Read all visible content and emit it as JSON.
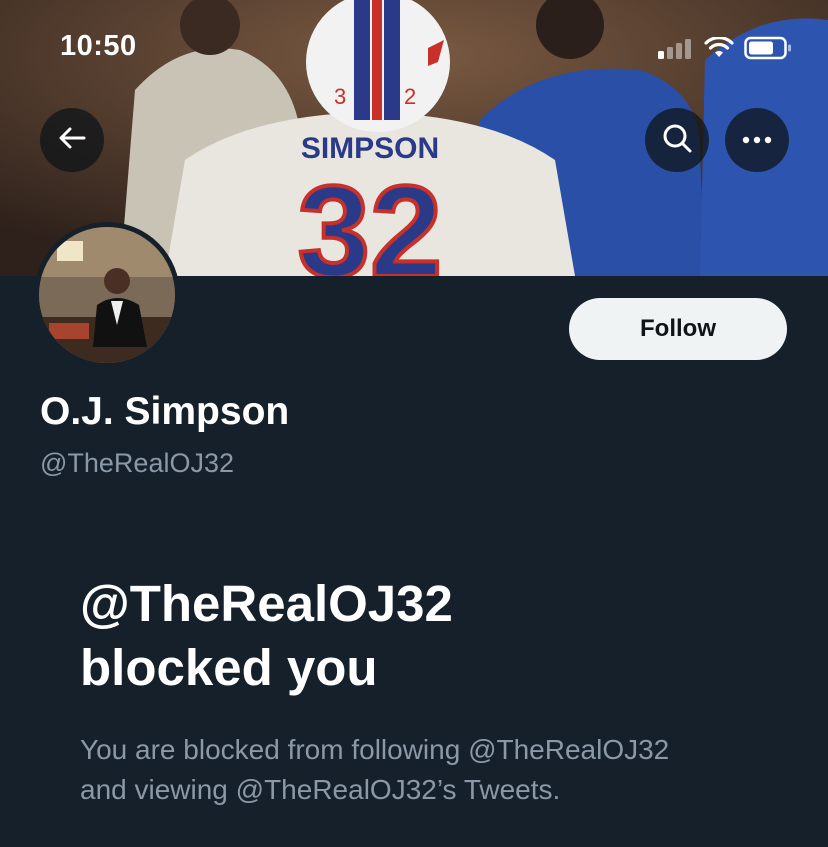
{
  "status_bar": {
    "time": "10:50"
  },
  "banner": {
    "jersey_name": "SIMPSON",
    "jersey_number": "32",
    "helmet_number_left": "3",
    "helmet_number_right": "2"
  },
  "profile": {
    "display_name": "O.J. Simpson",
    "handle": "@TheRealOJ32",
    "follow_label": "Follow"
  },
  "blocked": {
    "title_line1": "@TheRealOJ32",
    "title_line2": "blocked you",
    "desc_line1": "You are blocked from following @TheRealOJ32",
    "desc_line2": "and viewing @TheRealOJ32’s Tweets."
  },
  "colors": {
    "background": "#15202b",
    "follow_bg": "#eff3f4",
    "secondary_text": "#8b98a5"
  },
  "icons": {
    "back": "arrow-left-icon",
    "search": "search-icon",
    "more": "more-horizontal-icon"
  }
}
